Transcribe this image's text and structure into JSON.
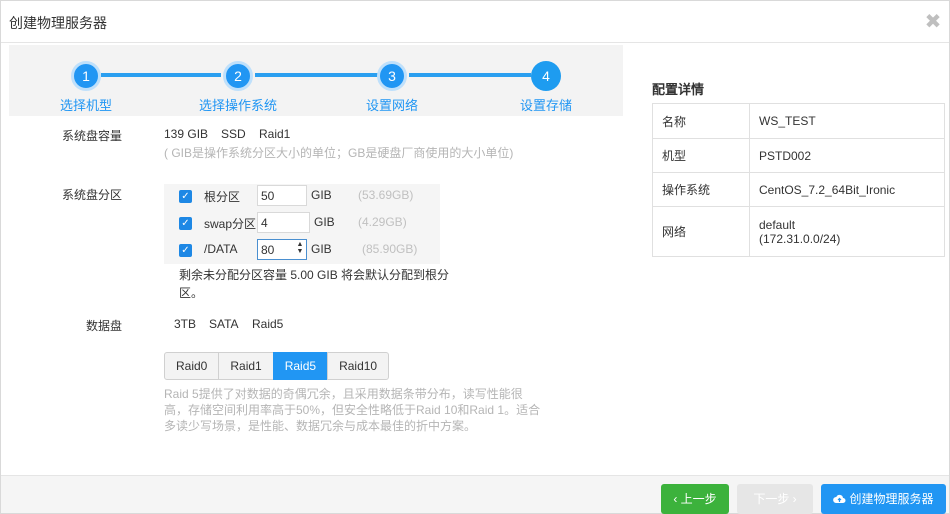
{
  "dialog": {
    "title": "创建物理服务器",
    "close_glyph": "✖"
  },
  "steps": [
    {
      "num": "1",
      "label": "选择机型"
    },
    {
      "num": "2",
      "label": "选择操作系统"
    },
    {
      "num": "3",
      "label": "设置网络"
    },
    {
      "num": "4",
      "label": "设置存储"
    }
  ],
  "system_disk": {
    "label": "系统盘容量",
    "capacity": "139 GIB",
    "type": "SSD",
    "raid": "Raid1",
    "hint": "( GIB是操作系统分区大小的单位；GB是硬盘厂商使用的大小单位)"
  },
  "partitions": {
    "label": "系统盘分区",
    "rows": [
      {
        "name": "根分区",
        "value": "50",
        "unit": "GIB",
        "size": "(53.69GB)",
        "checked": true
      },
      {
        "name": "swap分区",
        "value": "4",
        "unit": "GIB",
        "size": "(4.29GB)",
        "checked": true
      },
      {
        "name": "/DATA",
        "value": "80",
        "unit": "GIB",
        "size": "(85.90GB)",
        "checked": true
      }
    ],
    "remaining_line1": "剩余未分配分区容量 5.00 GIB 将会默认分配到根分",
    "remaining_line2": "区。"
  },
  "data_disk": {
    "label": "数据盘",
    "capacity": "3TB",
    "type": "SATA",
    "raid": "Raid5",
    "raid_options": [
      "Raid0",
      "Raid1",
      "Raid5",
      "Raid10"
    ],
    "raid_selected": "Raid5",
    "desc_line1": "Raid 5提供了对数据的奇偶冗余，且采用数据条带分布，读写性能很",
    "desc_line2": "高，存储空间利用率高于50%，但安全性略低于Raid 10和Raid 1。适合",
    "desc_line3": "多读少写场景，是性能、数据冗余与成本最佳的折中方案。"
  },
  "details": {
    "title": "配置详情",
    "rows": [
      {
        "key": "名称",
        "value": "WS_TEST"
      },
      {
        "key": "机型",
        "value": "PSTD002"
      },
      {
        "key": "操作系统",
        "value": "CentOS_7.2_64Bit_Ironic"
      },
      {
        "key": "网络",
        "value": "default",
        "value2": "(172.31.0.0/24)"
      }
    ]
  },
  "footer": {
    "prev_label": "‹ 上一步",
    "next_label": "下一步 ›",
    "create_label": "创建物理服务器"
  },
  "colors": {
    "primary": "#2196f3",
    "success": "#3cb23c",
    "disabled": "#e6e6e6"
  }
}
